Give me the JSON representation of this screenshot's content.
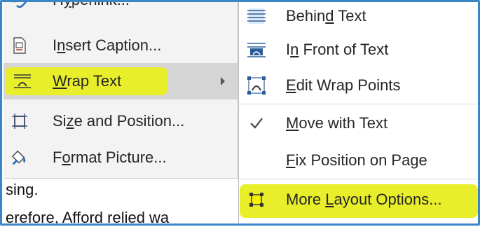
{
  "document": {
    "line1": "sing.",
    "line2": "erefore, Afford relied wa"
  },
  "context_menu": {
    "items": [
      {
        "pre": "H",
        "acc": "y",
        "post": "perlink...",
        "icon": "hyperlink-icon"
      },
      {
        "pre": "I",
        "acc": "n",
        "post": "sert Caption...",
        "icon": "insert-caption-icon"
      },
      {
        "pre": "",
        "acc": "W",
        "post": "rap Text",
        "icon": "wrap-text-icon"
      },
      {
        "pre": "Si",
        "acc": "z",
        "post": "e and Position...",
        "icon": "size-position-icon"
      },
      {
        "pre": "F",
        "acc": "o",
        "post": "rmat Picture...",
        "icon": "format-picture-icon"
      }
    ]
  },
  "submenu": {
    "items": [
      {
        "pre": "Behin",
        "acc": "d",
        "post": " Text",
        "icon": "behind-text-icon"
      },
      {
        "pre": "I",
        "acc": "n",
        "post": " Front of Text",
        "icon": "in-front-of-text-icon"
      },
      {
        "pre": "",
        "acc": "E",
        "post": "dit Wrap Points",
        "icon": "edit-wrap-points-icon"
      },
      {
        "pre": "",
        "acc": "M",
        "post": "ove with Text",
        "icon": "checkmark-icon"
      },
      {
        "pre": "",
        "acc": "F",
        "post": "ix Position on Page",
        "icon": ""
      },
      {
        "pre": "More ",
        "acc": "L",
        "post": "ayout Options...",
        "icon": "layout-options-icon"
      }
    ]
  },
  "colors": {
    "highlight": "#e8ef2a",
    "frame": "#3c86c8",
    "hover": "#d5d5d5"
  }
}
